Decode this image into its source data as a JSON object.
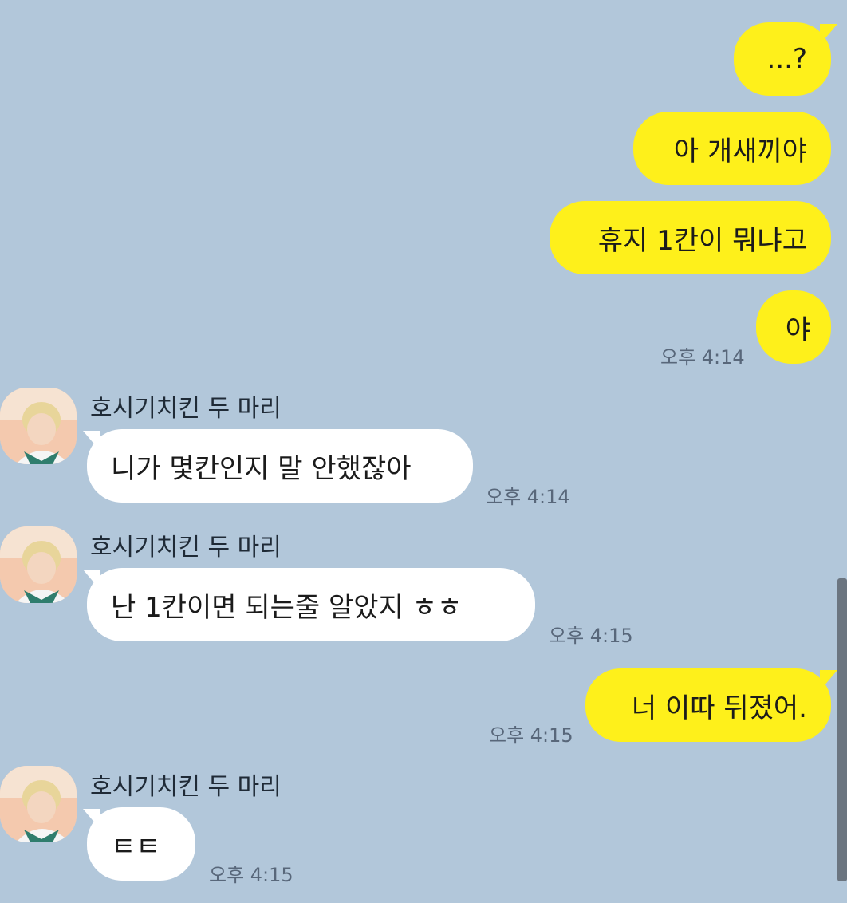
{
  "colors": {
    "background": "#b2c7da",
    "my_bubble": "#fef01b",
    "their_bubble": "#ffffff",
    "timestamp": "#58677a"
  },
  "messages": [
    {
      "from": "me",
      "text": "...?"
    },
    {
      "from": "me",
      "text": "아 개새끼야"
    },
    {
      "from": "me",
      "text": "휴지 1칸이 뭐냐고"
    },
    {
      "from": "me",
      "text": "야",
      "time": "오후 4:14"
    },
    {
      "from": "them",
      "sender": "호시기치킨 두 마리",
      "text": "니가 몇칸인지 말 안했잖아",
      "time": "오후 4:14"
    },
    {
      "from": "them",
      "sender": "호시기치킨 두 마리",
      "text": "난 1칸이면 되는줄 알았지 ㅎㅎ",
      "time": "오후 4:15"
    },
    {
      "from": "me",
      "text": "너 이따 뒤졌어.",
      "time": "오후 4:15"
    },
    {
      "from": "them",
      "sender": "호시기치킨 두 마리",
      "text": "ㅌㅌ",
      "time": "오후 4:15"
    }
  ],
  "avatar_icon": "profile-photo-avatar"
}
